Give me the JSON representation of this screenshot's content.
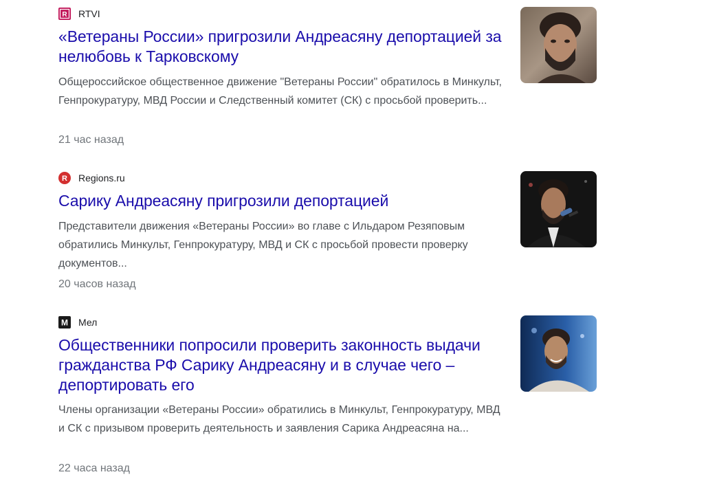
{
  "results": [
    {
      "source": "RTVI",
      "source_icon": "rtvi-logo-icon",
      "title": "«Ветераны России» пригрозили Андреасяну депортацией за нелюбовь к Тарковскому",
      "snippet": "Общероссийское общественное движение \"Ветераны России\" обратилось в Минкульт, Генпрокуратуру, МВД России и Следственный комитет (СК) с просьбой проверить...",
      "time": "21 час назад",
      "thumbnail": "man-portrait-thumbnail"
    },
    {
      "source": "Regions.ru",
      "source_icon": "regions-logo-icon",
      "title": "Сарику Андреасяну пригрозили депортацией",
      "snippet": "Представители движения «Ветераны России» во главе с Ильдаром Резяповым обратились Минкульт, Генпрокуратуру, МВД и СК с просьбой провести проверку документов...",
      "time": "20 часов назад",
      "thumbnail": "man-microphone-thumbnail"
    },
    {
      "source": "Мел",
      "source_icon": "mel-logo-icon",
      "title": "Общественники попросили проверить законность выдачи гражданства РФ Сарику Андреасяну и в случае чего – депортировать его",
      "snippet": "Члены организации «Ветераны России» обратились в Минкульт, Генпрокуратуру, МВД и СК с призывом проверить деятельность и заявления Сарика Андреасяна на...",
      "time": "22 часа назад",
      "thumbnail": "man-smiling-thumbnail"
    }
  ],
  "colors": {
    "link": "#1a0dab",
    "snippet": "#4d5156",
    "time": "#70757a",
    "rtvi": "#c2185b",
    "regions": "#d32f2f",
    "mel": "#1a1a1a"
  }
}
